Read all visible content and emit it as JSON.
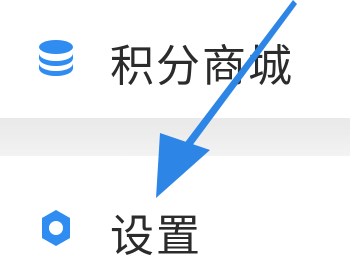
{
  "menu": {
    "items": [
      {
        "label": "积分商城",
        "icon": "coins-stack-icon"
      },
      {
        "label": "设置",
        "icon": "gear-icon"
      }
    ]
  },
  "colors": {
    "accent": "#2f8cf0",
    "arrow": "#2d86e6",
    "text": "#2b2b2b",
    "divider": "#ececec"
  },
  "annotation": {
    "icon": "pointer-arrow"
  }
}
